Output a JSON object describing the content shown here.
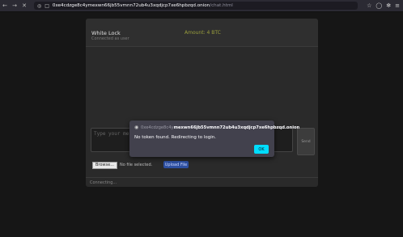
{
  "browser": {
    "back_icon": "arrow-left-icon",
    "forward_icon": "arrow-right-icon",
    "close_icon": "close-icon",
    "url_host": "0xe4cdzge8c4ymexwn66jb55vmnn72ub4u3xqdjcp7xe6hpbzqd.onion",
    "url_path": "/chat.html"
  },
  "chat": {
    "user_name": "White Lock",
    "user_status": "Connected as user",
    "amount": "Amount: 4 BTC",
    "input_placeholder": "Type your message...",
    "send_label": "Send",
    "browse_label": "Browse...",
    "no_file": "No file selected.",
    "upload_label": "Upload File",
    "status": "Connecting..."
  },
  "dialog": {
    "origin_prefix": "0xe4cdzge8c4y",
    "origin_host": "mexwn66jb55vmnn72ub4u3xqdjcp7xe6hpbzqd.onion",
    "message": "No token found. Redirecting to login.",
    "ok_label": "OK"
  },
  "colors": {
    "accent_ok": "#00ddff",
    "upload_blue": "#2d4fa0",
    "amount_text": "#9a9f3c"
  }
}
